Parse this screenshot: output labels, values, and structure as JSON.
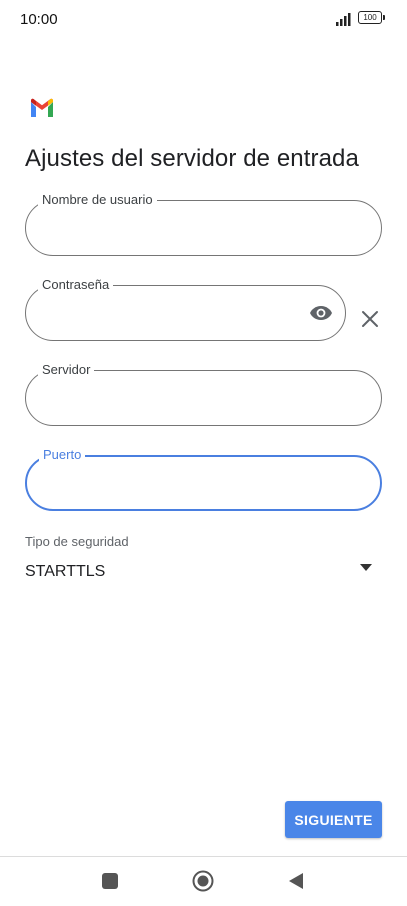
{
  "status_bar": {
    "time": "10:00",
    "battery": "100",
    "icons": [
      "signal-icon",
      "battery-icon"
    ]
  },
  "header": {
    "logo": "gmail-logo",
    "title": "Ajustes del servidor de entrada"
  },
  "form": {
    "username": {
      "label": "Nombre de usuario",
      "value": ""
    },
    "password": {
      "label": "Contraseña",
      "value": "",
      "icons": [
        "eye-icon",
        "close-icon"
      ]
    },
    "server": {
      "label": "Servidor",
      "value": ""
    },
    "port": {
      "label": "Puerto",
      "value": "",
      "focused": true
    },
    "security": {
      "label": "Tipo de seguridad",
      "selected": "STARTTLS"
    }
  },
  "actions": {
    "next_label": "SIGUIENTE"
  },
  "nav_bar": {
    "icons": [
      "recent-apps-icon",
      "home-icon",
      "back-icon"
    ]
  },
  "colors": {
    "accent": "#4a86e8",
    "focus_border": "#4a7fe0",
    "outline": "#757575",
    "text": "#202124"
  }
}
